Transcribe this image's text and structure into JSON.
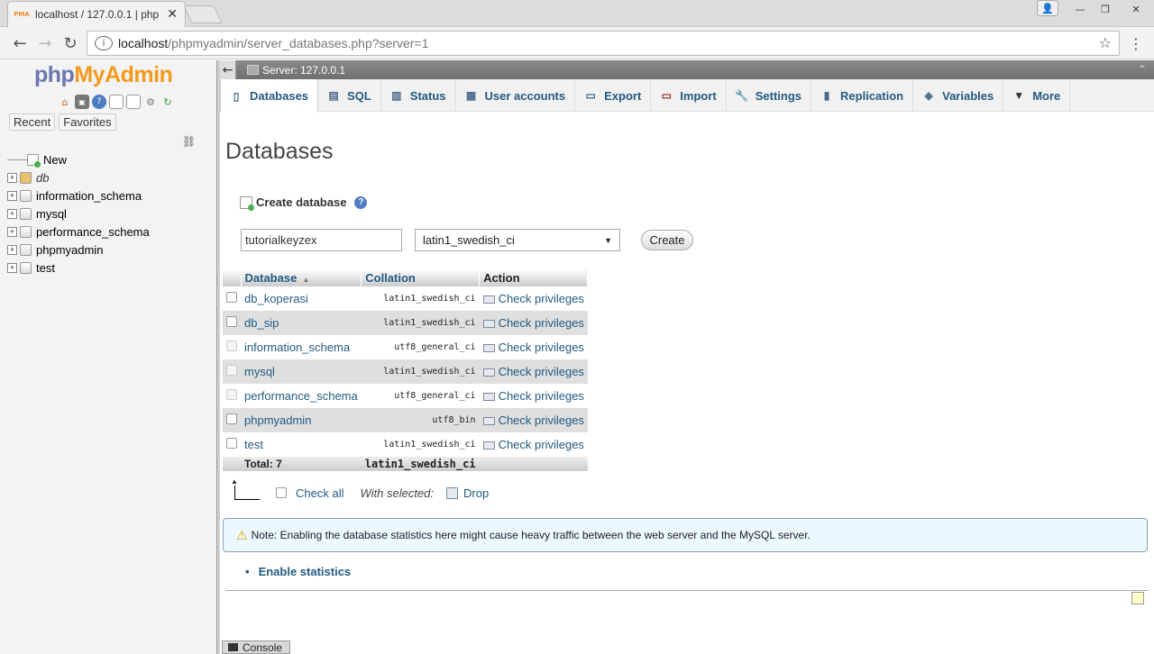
{
  "browser": {
    "tab_title": "localhost / 127.0.0.1 | php",
    "favicon_text": "PMA",
    "url_host": "localhost",
    "url_path": "/phpmyadmin/server_databases.php?server=1"
  },
  "sidebar": {
    "logo": {
      "php": "php",
      "my": "My",
      "admin": "Admin"
    },
    "tabs": [
      "Recent",
      "Favorites"
    ],
    "tree": [
      {
        "label": "New",
        "type": "new"
      },
      {
        "label": "db",
        "type": "db",
        "italic": true
      },
      {
        "label": "information_schema",
        "type": "db"
      },
      {
        "label": "mysql",
        "type": "db"
      },
      {
        "label": "performance_schema",
        "type": "db"
      },
      {
        "label": "phpmyadmin",
        "type": "db"
      },
      {
        "label": "test",
        "type": "db"
      }
    ]
  },
  "main": {
    "server_label": "Server: 127.0.0.1",
    "tabs": [
      {
        "label": "Databases",
        "icon": "database-icon",
        "active": true
      },
      {
        "label": "SQL",
        "icon": "sql-icon"
      },
      {
        "label": "Status",
        "icon": "status-icon"
      },
      {
        "label": "User accounts",
        "icon": "users-icon"
      },
      {
        "label": "Export",
        "icon": "export-icon"
      },
      {
        "label": "Import",
        "icon": "import-icon"
      },
      {
        "label": "Settings",
        "icon": "wrench-icon"
      },
      {
        "label": "Replication",
        "icon": "replication-icon"
      },
      {
        "label": "Variables",
        "icon": "variables-icon"
      },
      {
        "label": "More",
        "icon": "chevron-down-icon"
      }
    ],
    "page_title": "Databases",
    "create_db": {
      "label": "Create database",
      "name_value": "tutorialkeyzex",
      "collation_value": "latin1_swedish_ci",
      "button": "Create"
    },
    "table": {
      "headers": {
        "database": "Database",
        "collation": "Collation",
        "action": "Action"
      },
      "rows": [
        {
          "name": "db_koperasi",
          "collation": "latin1_swedish_ci",
          "action": "Check privileges",
          "checkbox_enabled": true
        },
        {
          "name": "db_sip",
          "collation": "latin1_swedish_ci",
          "action": "Check privileges",
          "checkbox_enabled": true
        },
        {
          "name": "information_schema",
          "collation": "utf8_general_ci",
          "action": "Check privileges",
          "checkbox_enabled": false
        },
        {
          "name": "mysql",
          "collation": "latin1_swedish_ci",
          "action": "Check privileges",
          "checkbox_enabled": false
        },
        {
          "name": "performance_schema",
          "collation": "utf8_general_ci",
          "action": "Check privileges",
          "checkbox_enabled": false
        },
        {
          "name": "phpmyadmin",
          "collation": "utf8_bin",
          "action": "Check privileges",
          "checkbox_enabled": true
        },
        {
          "name": "test",
          "collation": "latin1_swedish_ci",
          "action": "Check privileges",
          "checkbox_enabled": true
        }
      ],
      "total_label": "Total: 7",
      "total_collation": "latin1_swedish_ci"
    },
    "footer": {
      "check_all": "Check all",
      "with_selected": "With selected:",
      "drop": "Drop"
    },
    "notice": "Note: Enabling the database statistics here might cause heavy traffic between the web server and the MySQL server.",
    "enable_stats": "Enable statistics",
    "console": "Console"
  }
}
